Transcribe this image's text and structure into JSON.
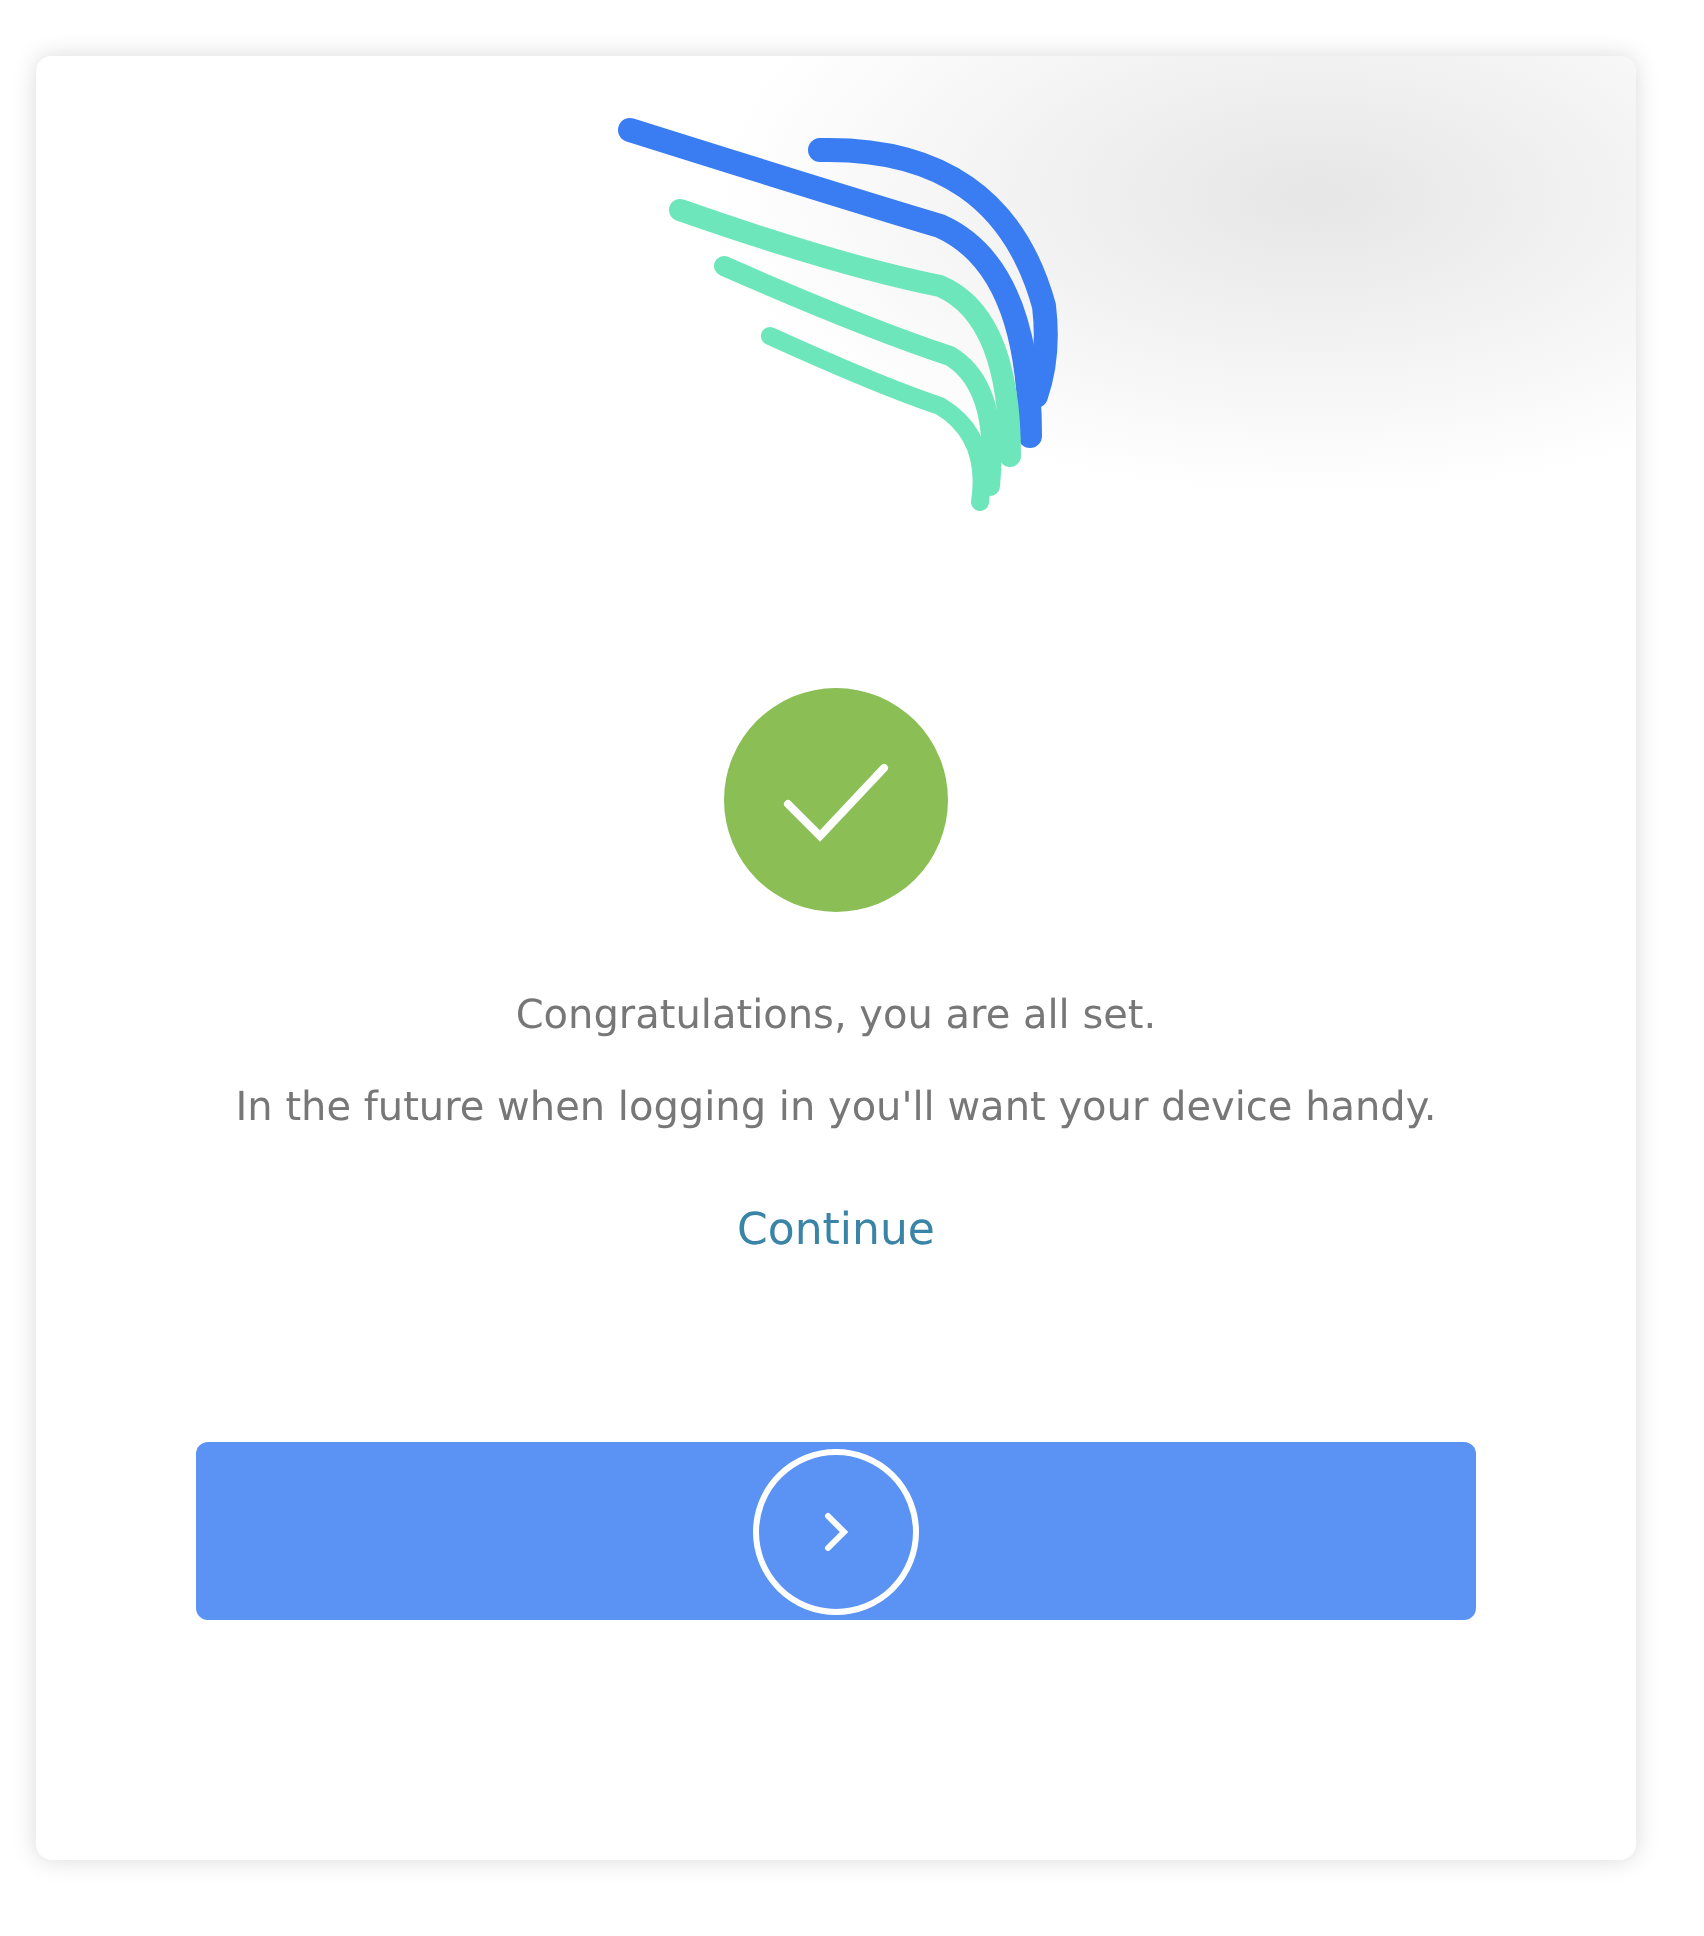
{
  "message": {
    "lines": [
      "Congratulations, you are all set.",
      "In the future when logging in you'll want your device handy."
    ]
  },
  "link": "Continue",
  "status": {
    "kind": "success"
  },
  "next_button": {
    "kind": "arrow"
  }
}
